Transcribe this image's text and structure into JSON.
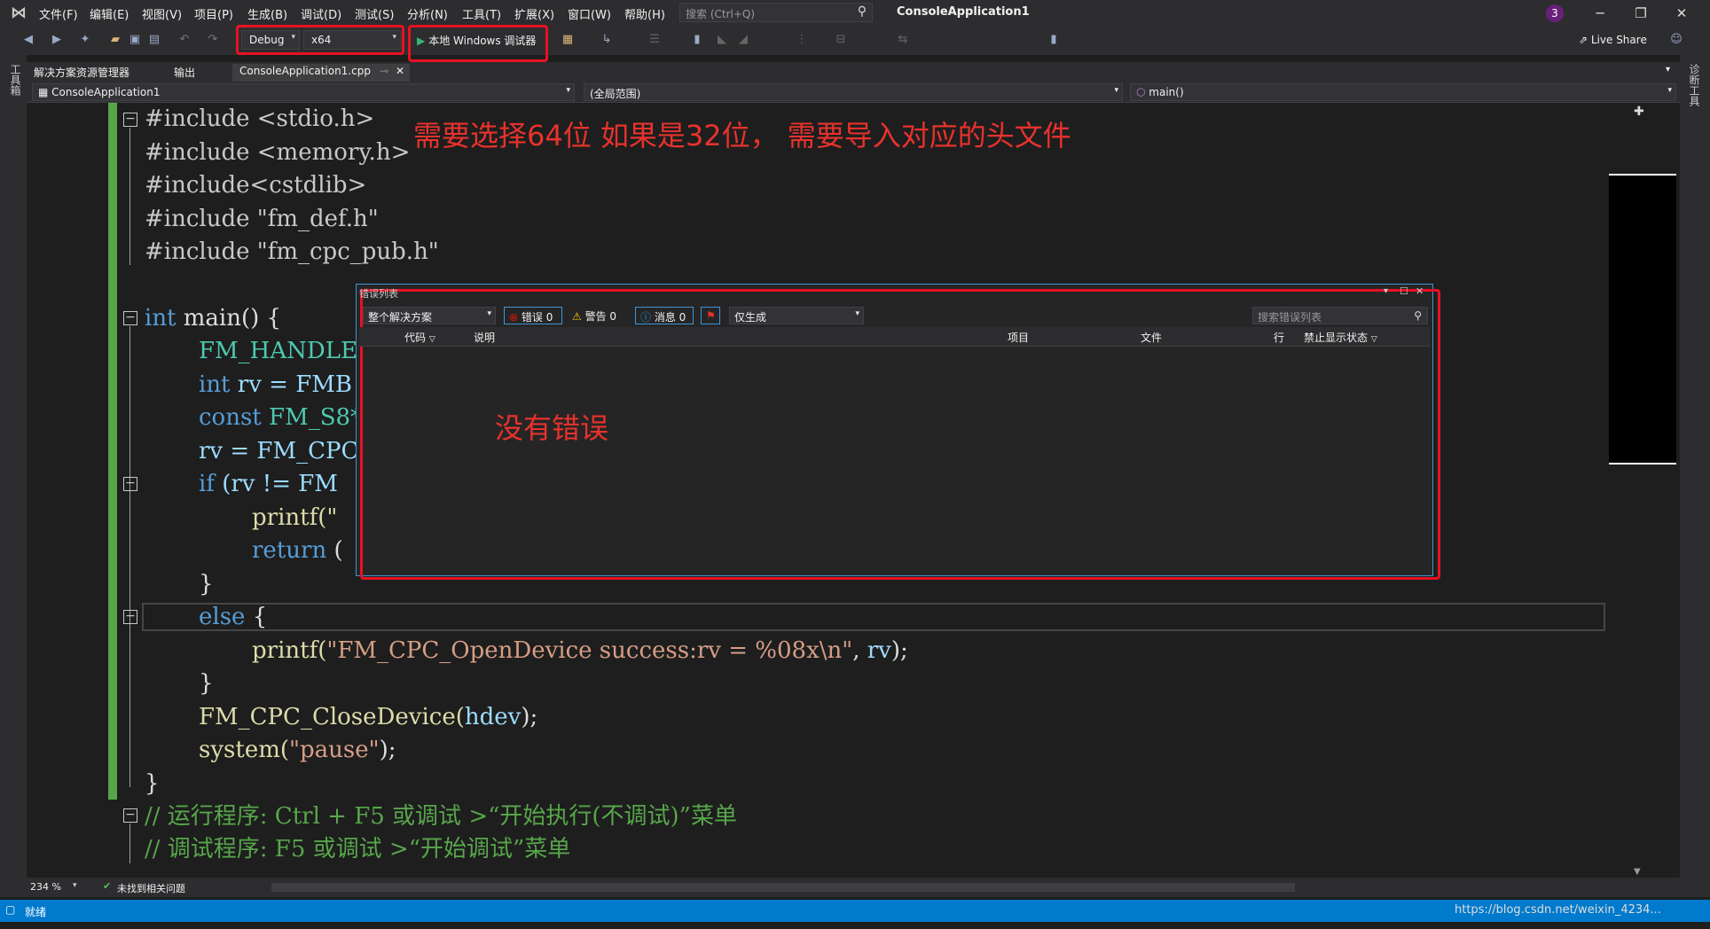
{
  "menu": [
    "文件(F)",
    "编辑(E)",
    "视图(V)",
    "项目(P)",
    "生成(B)",
    "调试(D)",
    "测试(S)",
    "分析(N)",
    "工具(T)",
    "扩展(X)",
    "窗口(W)",
    "帮助(H)"
  ],
  "search": {
    "placeholder": "搜索 (Ctrl+Q)"
  },
  "app_title": "ConsoleApplication1",
  "notification_count": "3",
  "toolbar": {
    "config": "Debug",
    "platform": "x64",
    "run_label": "本地 Windows 调试器",
    "live_share": "Live Share"
  },
  "side": {
    "left_label": "工具箱",
    "right_label": "诊断工具"
  },
  "tabs": {
    "solution_explorer": "解决方案资源管理器",
    "output": "输出",
    "file": "ConsoleApplication1.cpp"
  },
  "nav": {
    "project": "ConsoleApplication1",
    "scope": "(全局范围)",
    "member": "main()"
  },
  "annotation": "需要选择64位  如果是32位， 需要导入对应的头文件",
  "code": {
    "l1": "#include <stdio.h>",
    "l2": "#include <memory.h>",
    "l3": "#include<cstdlib>",
    "l4": "#include \"fm_def.h\"",
    "l5": "#include \"fm_cpc_pub.h\"",
    "main_kw": "int",
    "main_rest": " main() {",
    "c1": "FM_HANDLE ho",
    "c2_kw": "int",
    "c2_rest": " rv = FMB",
    "c3_kw": "const",
    "c3_rest": " FM_S8*",
    "c4": "rv = FM_CPC_",
    "c5_kw": "if",
    "c5_rest": " (rv != FM",
    "c6": "printf(\"",
    "c7_kw": "return",
    "c7_rest": " (",
    "c8": "}",
    "else_kw": "else",
    "else_rest": " {",
    "printf_fn": "printf(",
    "printf_str": "\"FM_CPC_OpenDevice success:rv = %08x\\n\"",
    "printf_rest": ", ",
    "printf_var": "rv",
    "printf_end": ");",
    "close_brace": "}",
    "close_fn": "FM_CPC_CloseDevice(",
    "close_var": "hdev",
    "close_end": ");",
    "sys_fn": "system(",
    "sys_str": "\"pause\"",
    "sys_end": ");",
    "end_brace": "}",
    "cmt1": "// 运行程序: Ctrl + F5 或调试 >“开始执行(不调试)”菜单",
    "cmt2": "// 调试程序: F5 或调试 >“开始调试”菜单"
  },
  "error_list": {
    "title": "错误列表",
    "scope": "整个解决方案",
    "errors": "错误 0",
    "warnings": "警告 0",
    "messages": "消息 0",
    "filter": "仅生成",
    "search_placeholder": "搜索错误列表",
    "columns": [
      "代码",
      "说明",
      "项目",
      "文件",
      "行",
      "禁止显示状态"
    ],
    "annotation": "没有错误"
  },
  "status": {
    "zoom": "234 %",
    "issues": "未找到相关问题",
    "ready": "就绪",
    "watermark": "https://blog.csdn.net/weixin_4234..."
  }
}
